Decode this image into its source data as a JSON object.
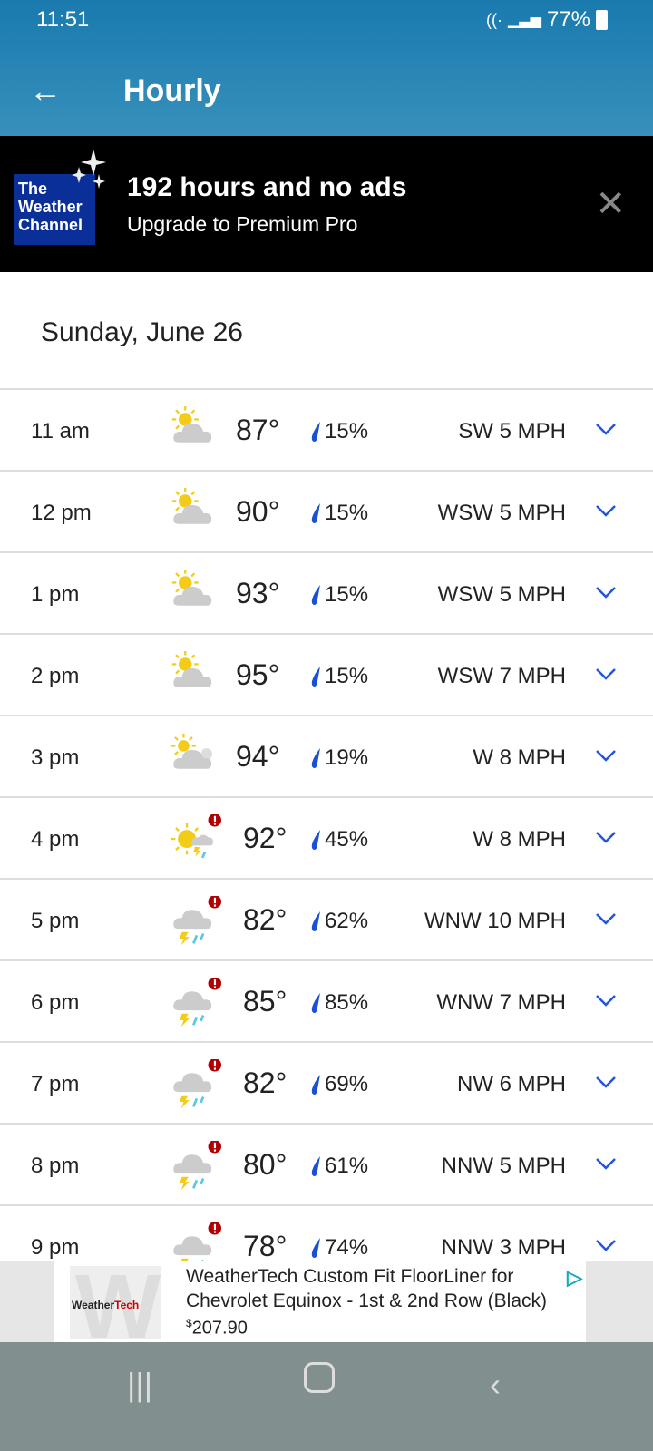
{
  "status": {
    "time": "11:51",
    "battery": "77%"
  },
  "appbar": {
    "title": "Hourly"
  },
  "promo": {
    "logo_text": "The Weather Channel",
    "headline": "192 hours and no ads",
    "subline": "Upgrade to Premium Pro"
  },
  "date_header": "Sunday, June 26",
  "colors": {
    "header": "#1a7aae",
    "chevron": "#2255dd",
    "drop": "#1a4fd6",
    "alert": "#b00000"
  },
  "hours": [
    {
      "time": "11 am",
      "icon": "partly-sunny",
      "temp": "87°",
      "precip": "15%",
      "wind": "SW 5 MPH",
      "alert": false
    },
    {
      "time": "12 pm",
      "icon": "partly-sunny",
      "temp": "90°",
      "precip": "15%",
      "wind": "WSW 5 MPH",
      "alert": false
    },
    {
      "time": "1 pm",
      "icon": "partly-sunny",
      "temp": "93°",
      "precip": "15%",
      "wind": "WSW 5 MPH",
      "alert": false
    },
    {
      "time": "2 pm",
      "icon": "partly-sunny",
      "temp": "95°",
      "precip": "15%",
      "wind": "WSW 7 MPH",
      "alert": false
    },
    {
      "time": "3 pm",
      "icon": "mostly-cloudy-sun",
      "temp": "94°",
      "precip": "19%",
      "wind": "W 8 MPH",
      "alert": false
    },
    {
      "time": "4 pm",
      "icon": "sun-thunderstorm",
      "temp": "92°",
      "precip": "45%",
      "wind": "W 8 MPH",
      "alert": true
    },
    {
      "time": "5 pm",
      "icon": "thunderstorm",
      "temp": "82°",
      "precip": "62%",
      "wind": "WNW 10 MPH",
      "alert": true
    },
    {
      "time": "6 pm",
      "icon": "thunderstorm",
      "temp": "85°",
      "precip": "85%",
      "wind": "WNW 7 MPH",
      "alert": true
    },
    {
      "time": "7 pm",
      "icon": "thunderstorm",
      "temp": "82°",
      "precip": "69%",
      "wind": "NW 6 MPH",
      "alert": true
    },
    {
      "time": "8 pm",
      "icon": "thunderstorm",
      "temp": "80°",
      "precip": "61%",
      "wind": "NNW 5 MPH",
      "alert": true
    },
    {
      "time": "9 pm",
      "icon": "thunderstorm",
      "temp": "78°",
      "precip": "74%",
      "wind": "NNW 3 MPH",
      "alert": true
    }
  ],
  "ad": {
    "brand": "WeatherTech",
    "title": "WeatherTech Custom Fit FloorLiner for Chevrolet Equinox - 1st & 2nd Row (Black)",
    "currency": "$",
    "price": "207.90"
  }
}
